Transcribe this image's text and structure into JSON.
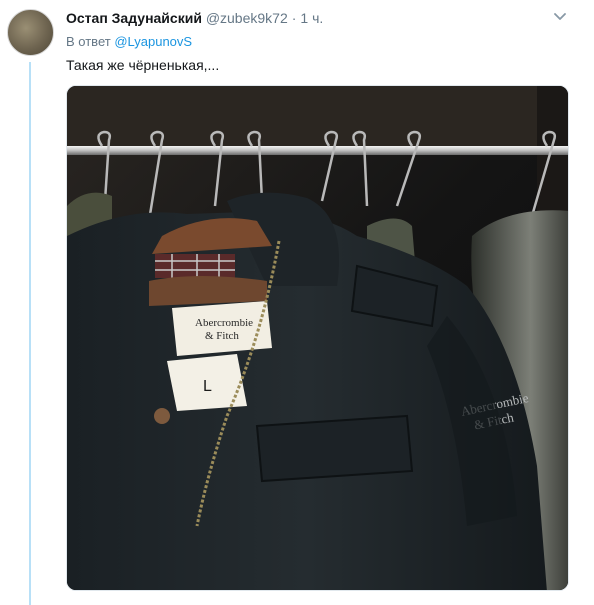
{
  "tweet": {
    "author_name": "Остап Задунайский",
    "handle": "@zubek9k72",
    "separator": "·",
    "time": "1 ч.",
    "reply_prefix": "В ответ ",
    "reply_mention": "@LyapunovS",
    "text": "Такая же чёрненькая,...",
    "media": {
      "brand_left": [
        "Abercrombie",
        "& Fitch"
      ],
      "size_label": "L",
      "brand_right": [
        "Abercrombie",
        "& Fitch"
      ]
    }
  },
  "icons": {
    "caret": "chevron-down-icon",
    "avatar": "avatar"
  },
  "colors": {
    "link": "#1b95e0",
    "secondary": "#657786",
    "thread_line": "#b8e0f7"
  }
}
